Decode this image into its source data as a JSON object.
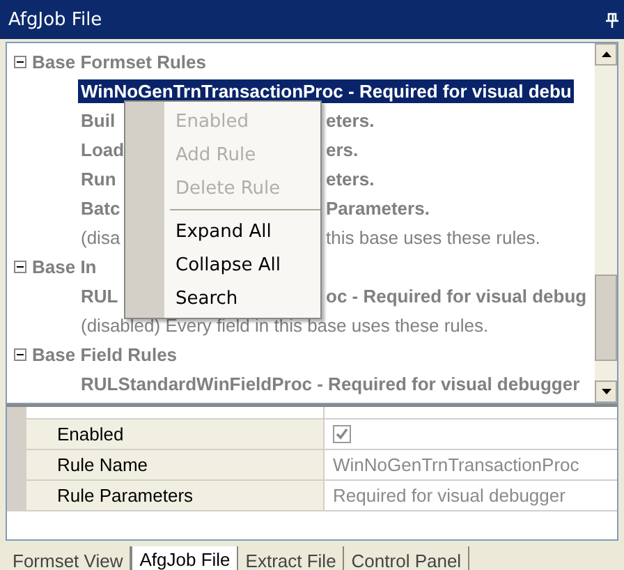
{
  "window": {
    "title": "AfgJob File"
  },
  "tree": [
    {
      "label": "Base Formset Rules",
      "expanded": true,
      "children": [
        {
          "label": "WinNoGenTrnTransactionProc - Required for visual debu",
          "kind": "rule",
          "selected": true
        },
        {
          "label": "Buil",
          "tail": "eters.",
          "kind": "rule",
          "selected": false
        },
        {
          "label": "Load",
          "tail": "ers.",
          "kind": "rule",
          "selected": false
        },
        {
          "label": "Run",
          "tail": "eters.",
          "kind": "rule",
          "selected": false
        },
        {
          "label": "Batc",
          "tail": "Parameters.",
          "kind": "rule",
          "selected": false
        },
        {
          "label": "(disa",
          "tail": "this base uses these rules.",
          "kind": "note",
          "selected": false
        }
      ]
    },
    {
      "label": "Base In",
      "expanded": true,
      "children": [
        {
          "label": "RUL",
          "tail": "oc - Required for visual debug",
          "kind": "rule",
          "selected": false
        },
        {
          "label": "(disabled)    Every field in this base uses these rules.",
          "kind": "note",
          "selected": false
        }
      ]
    },
    {
      "label": "Base Field Rules",
      "expanded": true,
      "children": [
        {
          "label": "RULStandardWinFieldProc - Required for visual debugger",
          "kind": "rule",
          "selected": false
        }
      ]
    }
  ],
  "context_menu": [
    {
      "label": "Enabled",
      "disabled": true,
      "separator_after": false
    },
    {
      "label": "Add Rule",
      "disabled": true,
      "separator_after": false
    },
    {
      "label": "Delete Rule",
      "disabled": true,
      "separator_after": true
    },
    {
      "label": "Expand All",
      "disabled": false,
      "separator_after": false
    },
    {
      "label": "Collapse All",
      "disabled": false,
      "separator_after": false
    },
    {
      "label": "Search",
      "disabled": false,
      "separator_after": false
    }
  ],
  "properties": [
    {
      "name": "Enabled",
      "kind": "checkbox",
      "checked": true
    },
    {
      "name": "Rule Name",
      "kind": "text",
      "value": "WinNoGenTrnTransactionProc"
    },
    {
      "name": "Rule Parameters",
      "kind": "text",
      "value": "Required for visual debugger"
    }
  ],
  "tabs": [
    {
      "label": "Formset View",
      "selected": false
    },
    {
      "label": "AfgJob File",
      "selected": true
    },
    {
      "label": "Extract File",
      "selected": false
    },
    {
      "label": "Control Panel",
      "selected": false
    }
  ]
}
